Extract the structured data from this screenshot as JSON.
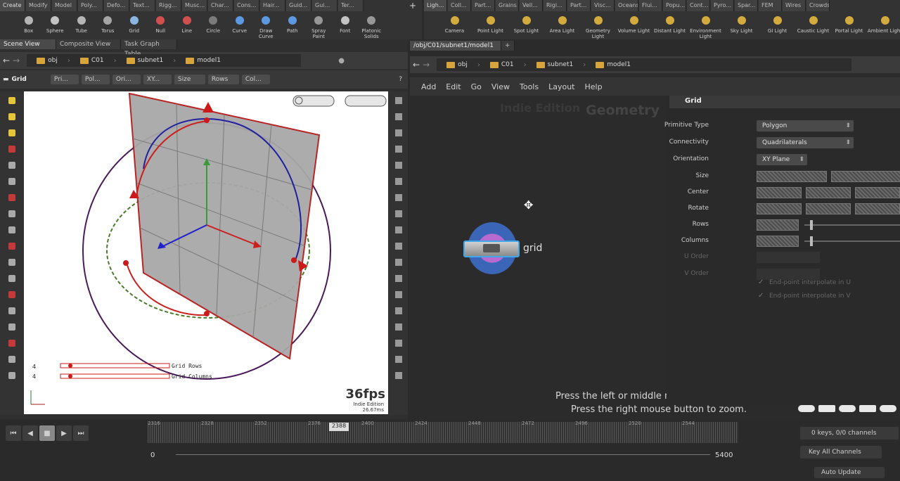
{
  "shelf_left": {
    "tabs": [
      "Create",
      "Modify",
      "Model",
      "Poly...",
      "Defo...",
      "Text...",
      "Rigg...",
      "Musc...",
      "Char...",
      "Cons...",
      "Hair...",
      "Guid...",
      "Gui...",
      "Ter..."
    ],
    "tools": [
      {
        "label": "Box",
        "icon": "box-icon"
      },
      {
        "label": "Sphere",
        "icon": "sphere-icon"
      },
      {
        "label": "Tube",
        "icon": "tube-icon"
      },
      {
        "label": "Torus",
        "icon": "torus-icon"
      },
      {
        "label": "Grid",
        "icon": "grid-icon"
      },
      {
        "label": "Null",
        "icon": "null-icon"
      },
      {
        "label": "Line",
        "icon": "line-icon"
      },
      {
        "label": "Circle",
        "icon": "circle-icon"
      },
      {
        "label": "Curve",
        "icon": "curve-icon"
      },
      {
        "label": "Draw Curve",
        "icon": "draw-curve-icon"
      },
      {
        "label": "Path",
        "icon": "path-icon"
      },
      {
        "label": "Spray Paint",
        "icon": "spray-paint-icon"
      },
      {
        "label": "Font",
        "icon": "font-icon"
      },
      {
        "label": "Platonic Solids",
        "icon": "platonic-icon"
      }
    ]
  },
  "shelf_right": {
    "tabs": [
      "Ligh...",
      "Coll...",
      "Part...",
      "Grains",
      "Vell...",
      "Rigi...",
      "Part...",
      "Visc...",
      "Oceans",
      "Flui...",
      "Popu...",
      "Cont...",
      "Pyro...",
      "Spar...",
      "FEM",
      "Wires",
      "Crowds"
    ],
    "tools": [
      {
        "label": "Camera",
        "icon": "camera-icon"
      },
      {
        "label": "Point Light",
        "icon": "point-light-icon"
      },
      {
        "label": "Spot Light",
        "icon": "spot-light-icon"
      },
      {
        "label": "Area Light",
        "icon": "area-light-icon"
      },
      {
        "label": "Geometry Light",
        "icon": "geometry-light-icon"
      },
      {
        "label": "Volume Light",
        "icon": "volume-light-icon"
      },
      {
        "label": "Distant Light",
        "icon": "distant-light-icon"
      },
      {
        "label": "Environment Light",
        "icon": "environment-light-icon"
      },
      {
        "label": "Sky Light",
        "icon": "sky-light-icon"
      },
      {
        "label": "GI Light",
        "icon": "gi-light-icon"
      },
      {
        "label": "Caustic Light",
        "icon": "caustic-light-icon"
      },
      {
        "label": "Portal Light",
        "icon": "portal-light-icon"
      },
      {
        "label": "Ambient Light",
        "icon": "ambient-light-icon"
      }
    ]
  },
  "left_pane": {
    "tabs": [
      "Scene View",
      "Composite View",
      "Task Graph Table"
    ],
    "path": [
      "obj",
      "C01",
      "subnet1",
      "model1"
    ],
    "op_label": "Grid",
    "op_fields": [
      "Pri...",
      "Pol...",
      "Ori...",
      "XY...",
      "Size",
      "Rows",
      "Col..."
    ],
    "viewport": {
      "row_count": "4",
      "col_count": "4",
      "rows_label": "Grid Rows",
      "cols_label": "Grid Columns",
      "fps": "36fps",
      "edition": "Indie Edition",
      "ms": "26.67ms"
    }
  },
  "right_pane": {
    "tab": "/obj/C01/subnet1/model1",
    "path": [
      "obj",
      "C01",
      "subnet1",
      "model1"
    ],
    "menu": [
      "Add",
      "Edit",
      "Go",
      "View",
      "Tools",
      "Layout",
      "Help"
    ],
    "watermark_left": "Indie Edition",
    "watermark_right": "Geometry",
    "node_label": "grid",
    "hint1": "Press the left or middle mouse button to pan.",
    "hint2": "Press the right mouse button to zoom.",
    "params": {
      "title": "Grid",
      "rows": [
        {
          "label": "Primitive Type",
          "value": "Polygon",
          "kind": "drop"
        },
        {
          "label": "Connectivity",
          "value": "Quadrilaterals",
          "kind": "drop"
        },
        {
          "label": "Orientation",
          "value": "XY Plane",
          "kind": "drop"
        },
        {
          "label": "Size",
          "kind": "fields2"
        },
        {
          "label": "Center",
          "kind": "fields3"
        },
        {
          "label": "Rotate",
          "kind": "fields3"
        },
        {
          "label": "Rows",
          "kind": "slider"
        },
        {
          "label": "Columns",
          "kind": "slider"
        },
        {
          "label": "U Order",
          "kind": "dim"
        },
        {
          "label": "V Order",
          "kind": "dim"
        }
      ],
      "check1": "End-point interpolate in U",
      "check2": "End-point interpolate in V"
    }
  },
  "timeline": {
    "start": "0",
    "end": "5400",
    "ticks": [
      "2316",
      "2328",
      "2352",
      "2376",
      "2400",
      "2424",
      "2448",
      "2472",
      "2496",
      "2520",
      "2544"
    ],
    "frame": "2388",
    "keys": "0 keys, 0/0 channels",
    "key_all": "Key All Channels",
    "auto_update": "Auto Update"
  }
}
